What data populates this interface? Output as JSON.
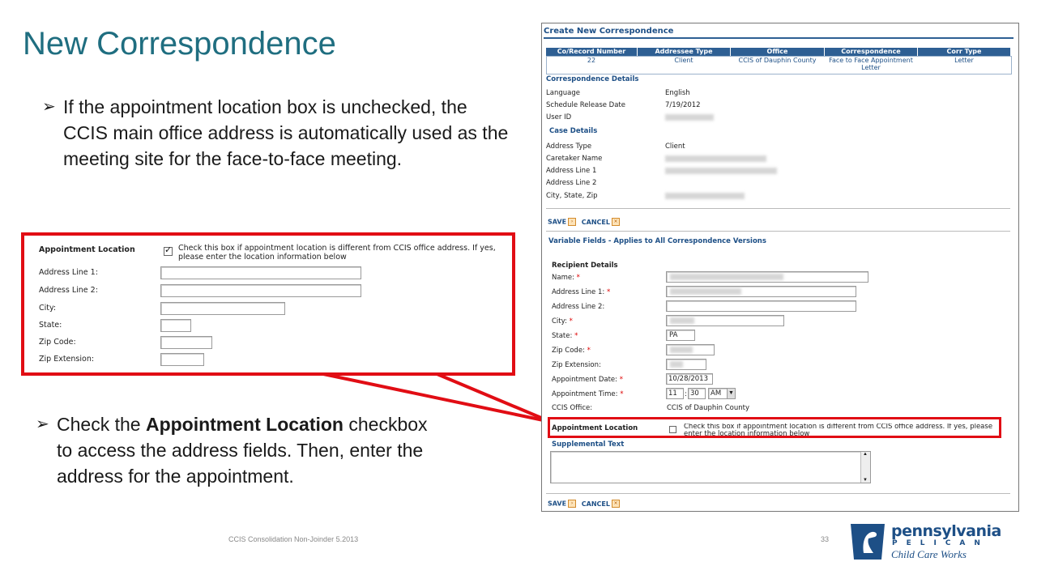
{
  "slide": {
    "title": "New Correspondence",
    "bullet1": "If the appointment location box is unchecked, the CCIS main office address is automatically used as the meeting site for the face-to-face meeting.",
    "bullet2_pre": "Check the ",
    "bullet2_bold": "Appointment Location",
    "bullet2_post": " checkbox to access the address fields. Then, enter the address for the appointment.",
    "footer": "CCIS Consolidation Non-Joinder 5.2013",
    "page_number": "33"
  },
  "inset": {
    "label": "Appointment Location",
    "checkbox_text": "Check this box if appointment location is different from CCIS office address. If yes, please enter the location information below",
    "fields": [
      "Address Line 1:",
      "Address Line 2:",
      "City:",
      "State:",
      "Zip Code:",
      "Zip Extension:"
    ]
  },
  "screen": {
    "header": "Create New Correspondence",
    "grid_headers": [
      "Co/Record Number",
      "Addressee Type",
      "Office",
      "Correspondence",
      "Corr Type"
    ],
    "grid_row": [
      "22",
      "Client",
      "CCIS of Dauphin County",
      "Face to Face Appointment Letter",
      "Letter"
    ],
    "correspondence_details": "Correspondence Details",
    "language_label": "Language",
    "language_value": "English",
    "release_label": "Schedule Release Date",
    "release_value": "7/19/2012",
    "userid_label": "User ID",
    "case_details": "Case Details",
    "address_type_label": "Address Type",
    "address_type_value": "Client",
    "caretaker_label": "Caretaker Name",
    "addr1_label": "Address Line 1",
    "addr2_label": "Address Line 2",
    "city_label": "City, State, Zip",
    "save": "SAVE",
    "cancel": "CANCEL",
    "variable_fields": "Variable Fields - Applies to All Correspondence Versions",
    "recipient_details": "Recipient Details",
    "name_label": "Name:",
    "r_addr1_label": "Address Line 1:",
    "r_addr2_label": "Address Line 2:",
    "r_city_label": "City:",
    "r_state_label": "State:",
    "r_state_value": "PA",
    "r_zip_label": "Zip Code:",
    "r_zipext_label": "Zip Extension:",
    "appt_date_label": "Appointment Date:",
    "appt_date_value": "10/28/2013",
    "appt_time_label": "Appointment Time:",
    "appt_hour": "11",
    "appt_min": "30",
    "appt_ampm": "AM",
    "ccis_office_label": "CCIS Office:",
    "ccis_office_value": "CCIS of Dauphin County",
    "appt_location_label": "Appointment Location",
    "appt_location_text": "Check this box if appointment location is different from CCIS office address. If yes, please enter the location information below",
    "supplemental": "Supplemental Text",
    "required": "*",
    "colon": ":"
  },
  "logo": {
    "line1": "pennsylvania",
    "line2": "PELICAN",
    "line3": "Child Care Works"
  }
}
